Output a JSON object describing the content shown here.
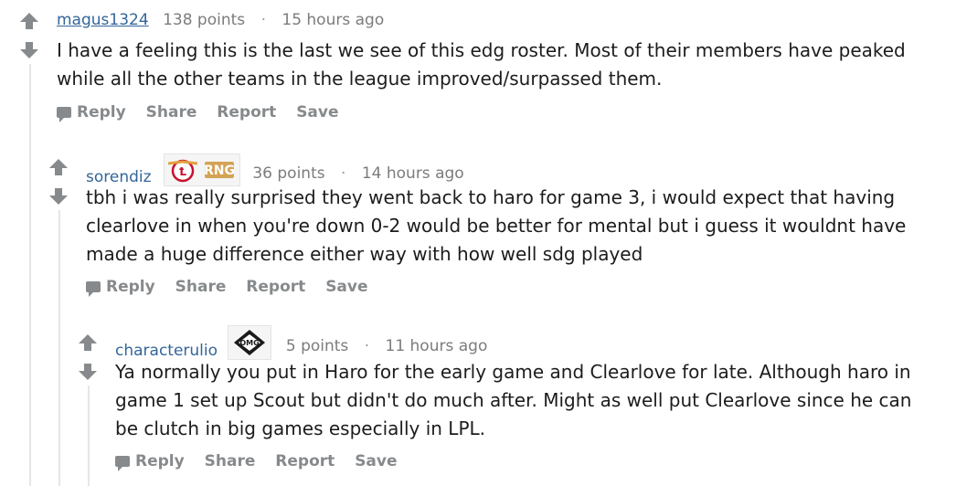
{
  "comments": [
    {
      "author": "magus1324",
      "points": "138 points",
      "time": "15 hours ago",
      "body": "I have a feeling this is the last we see of this edg roster. Most of their members have peaked while all the other teams in the league improved/surpassed them.",
      "actions": [
        "Reply",
        "Share",
        "Report",
        "Save"
      ]
    },
    {
      "author": "sorendiz",
      "flair": "skt-rng-flair-icon",
      "points": "36 points",
      "time": "14 hours ago",
      "body": "tbh i was really surprised they went back to haro for game 3, i would expect that having clearlove in when you're down 0-2 would be better for mental but i guess it wouldnt have made a huge difference either way with how well sdg played",
      "actions": [
        "Reply",
        "Share",
        "Report",
        "Save"
      ]
    },
    {
      "author": "characterulio",
      "flair": "omg-flair-icon",
      "points": "5 points",
      "time": "11 hours ago",
      "body": "Ya normally you put in Haro for the early game and Clearlove for late. Although haro in game 1 set up Scout but didn't do much after. Might as well put Clearlove since he can be clutch in big games especially in LPL.",
      "actions": [
        "Reply",
        "Share",
        "Report",
        "Save"
      ]
    }
  ],
  "colors": {
    "author": "#336699",
    "muted": "#7c7c7c",
    "arrow": "#878a8c"
  }
}
